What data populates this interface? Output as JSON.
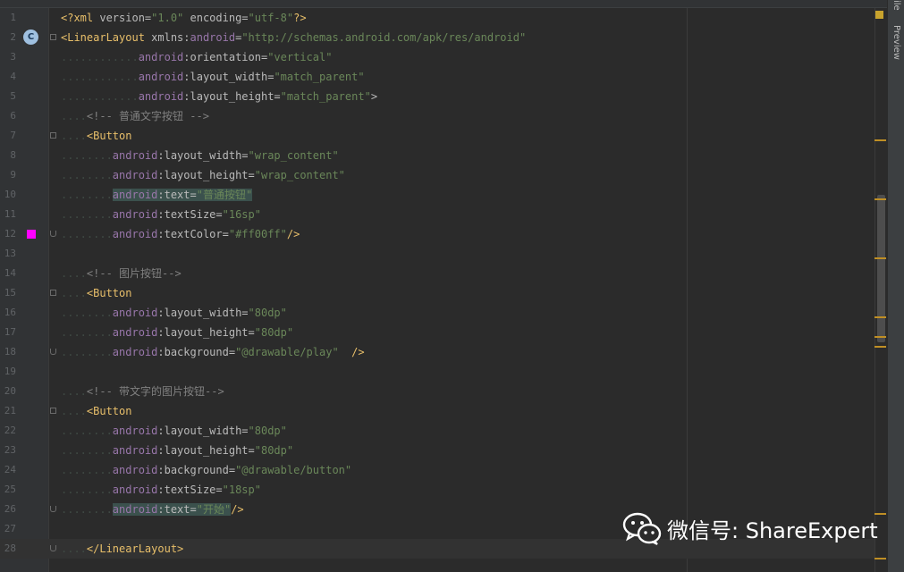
{
  "editor": {
    "lines": [
      {
        "n": "1",
        "tokens": [
          [
            "pi",
            "<?xml "
          ],
          [
            "attr",
            "version="
          ],
          [
            "val",
            "\"1.0\""
          ],
          [
            "attr",
            " encoding="
          ],
          [
            "val",
            "\"utf-8\""
          ],
          [
            "pi",
            "?>"
          ]
        ]
      },
      {
        "n": "2",
        "tokens": [
          [
            "tag",
            "<LinearLayout"
          ],
          [
            "attr",
            " xmlns:"
          ],
          [
            "ns",
            "android"
          ],
          [
            "attr",
            "="
          ],
          [
            "val",
            "\"http://schemas.android.com/apk/res/android\""
          ]
        ]
      },
      {
        "n": "3",
        "tokens": [
          [
            "dots",
            "............"
          ],
          [
            "ns",
            "android"
          ],
          [
            "attr",
            ":orientation="
          ],
          [
            "val",
            "\"vertical\""
          ]
        ]
      },
      {
        "n": "4",
        "tokens": [
          [
            "dots",
            "............"
          ],
          [
            "ns",
            "android"
          ],
          [
            "attr",
            ":layout_width="
          ],
          [
            "val",
            "\"match_parent\""
          ]
        ]
      },
      {
        "n": "5",
        "tokens": [
          [
            "dots",
            "............"
          ],
          [
            "ns",
            "android"
          ],
          [
            "attr",
            ":layout_height="
          ],
          [
            "val",
            "\"match_parent\""
          ],
          [
            "attr",
            ">"
          ]
        ]
      },
      {
        "n": "6",
        "tokens": [
          [
            "dots",
            "...."
          ],
          [
            "cm",
            "<!-- 普通文字按钮 -->"
          ]
        ]
      },
      {
        "n": "7",
        "tokens": [
          [
            "dots",
            "...."
          ],
          [
            "tag",
            "<Button"
          ]
        ]
      },
      {
        "n": "8",
        "tokens": [
          [
            "dots",
            "........"
          ],
          [
            "ns",
            "android"
          ],
          [
            "attr",
            ":layout_width="
          ],
          [
            "val",
            "\"wrap_content\""
          ]
        ]
      },
      {
        "n": "9",
        "tokens": [
          [
            "dots",
            "........"
          ],
          [
            "ns",
            "android"
          ],
          [
            "attr",
            ":layout_height="
          ],
          [
            "val",
            "\"wrap_content\""
          ]
        ]
      },
      {
        "n": "10",
        "tokens": [
          [
            "dots",
            "........"
          ],
          [
            "hlns",
            "android"
          ],
          [
            "hlattr",
            ":text="
          ],
          [
            "hlval",
            "\"普通按钮\""
          ]
        ]
      },
      {
        "n": "11",
        "tokens": [
          [
            "dots",
            "........"
          ],
          [
            "ns",
            "android"
          ],
          [
            "attr",
            ":textSize="
          ],
          [
            "val",
            "\"16sp\""
          ]
        ]
      },
      {
        "n": "12",
        "tokens": [
          [
            "dots",
            "........"
          ],
          [
            "ns",
            "android"
          ],
          [
            "attr",
            ":textColor="
          ],
          [
            "val",
            "\"#ff00ff\""
          ],
          [
            "tag",
            "/>"
          ]
        ]
      },
      {
        "n": "13",
        "tokens": []
      },
      {
        "n": "14",
        "tokens": [
          [
            "dots",
            "...."
          ],
          [
            "cm",
            "<!-- 图片按钮-->"
          ]
        ]
      },
      {
        "n": "15",
        "tokens": [
          [
            "dots",
            "...."
          ],
          [
            "tag",
            "<Button"
          ]
        ]
      },
      {
        "n": "16",
        "tokens": [
          [
            "dots",
            "........"
          ],
          [
            "ns",
            "android"
          ],
          [
            "attr",
            ":layout_width="
          ],
          [
            "val",
            "\"80dp\""
          ]
        ]
      },
      {
        "n": "17",
        "tokens": [
          [
            "dots",
            "........"
          ],
          [
            "ns",
            "android"
          ],
          [
            "attr",
            ":layout_height="
          ],
          [
            "val",
            "\"80dp\""
          ]
        ]
      },
      {
        "n": "18",
        "tokens": [
          [
            "dots",
            "........"
          ],
          [
            "ns",
            "android"
          ],
          [
            "attr",
            ":background="
          ],
          [
            "val",
            "\"@drawable/play\""
          ],
          [
            "tag",
            "  />"
          ]
        ]
      },
      {
        "n": "19",
        "tokens": []
      },
      {
        "n": "20",
        "tokens": [
          [
            "dots",
            "...."
          ],
          [
            "cm",
            "<!-- 带文字的图片按钮-->"
          ]
        ]
      },
      {
        "n": "21",
        "tokens": [
          [
            "dots",
            "...."
          ],
          [
            "tag",
            "<Button"
          ]
        ]
      },
      {
        "n": "22",
        "tokens": [
          [
            "dots",
            "........"
          ],
          [
            "ns",
            "android"
          ],
          [
            "attr",
            ":layout_width="
          ],
          [
            "val",
            "\"80dp\""
          ]
        ]
      },
      {
        "n": "23",
        "tokens": [
          [
            "dots",
            "........"
          ],
          [
            "ns",
            "android"
          ],
          [
            "attr",
            ":layout_height="
          ],
          [
            "val",
            "\"80dp\""
          ]
        ]
      },
      {
        "n": "24",
        "tokens": [
          [
            "dots",
            "........"
          ],
          [
            "ns",
            "android"
          ],
          [
            "attr",
            ":background="
          ],
          [
            "val",
            "\"@drawable/button\""
          ]
        ]
      },
      {
        "n": "25",
        "tokens": [
          [
            "dots",
            "........"
          ],
          [
            "ns",
            "android"
          ],
          [
            "attr",
            ":textSize="
          ],
          [
            "val",
            "\"18sp\""
          ]
        ]
      },
      {
        "n": "26",
        "tokens": [
          [
            "dots",
            "........"
          ],
          [
            "hlns",
            "android"
          ],
          [
            "hlattr",
            ":text="
          ],
          [
            "hlval",
            "\"开始\""
          ],
          [
            "tag",
            "/>"
          ]
        ]
      },
      {
        "n": "27",
        "tokens": []
      },
      {
        "n": "28",
        "tokens": [
          [
            "dots",
            "...."
          ],
          [
            "tag",
            "</LinearLayout>"
          ]
        ]
      }
    ],
    "gutter_badge": "C",
    "swatch_color": "#ff00ff"
  },
  "sidebar": {
    "top_label": "ile",
    "preview_label": "Preview"
  },
  "watermark": {
    "text": "微信号: ShareExpert"
  },
  "colors": {
    "tag": "#e8bf6a",
    "namespace": "#9876aa",
    "value": "#6a8759",
    "comment": "#808080"
  }
}
